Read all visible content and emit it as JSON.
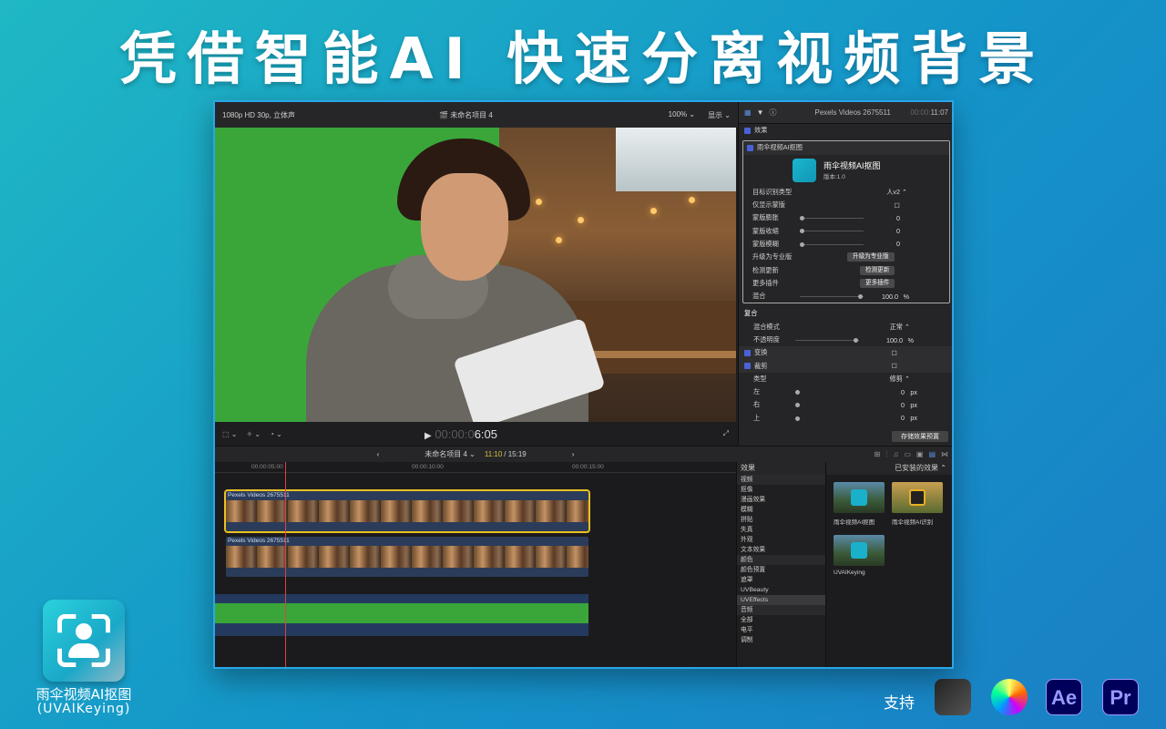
{
  "headline": "凭借智能AI 快速分离视频背景",
  "viewer": {
    "format": "1080p HD 30p, 立体声",
    "project": "未命名项目 4",
    "zoom": "100% ⌄",
    "display": "显示 ⌄",
    "timecode_dim": "00:00:0",
    "timecode": "6:05"
  },
  "inspector": {
    "clip_name": "Pexels Videos 2675511",
    "timecode_dim": "00:00:",
    "timecode": "11:07",
    "effects_label": "效果",
    "plugin_label": "雨伞视频AI抠图",
    "plugin_title": "雨伞视频AI抠图",
    "plugin_version": "版本:1.0",
    "params": [
      {
        "label": "目标识别类型",
        "value": "人v2 ⌃"
      },
      {
        "label": "仅显示蒙版",
        "value": "☐"
      },
      {
        "label": "蒙版膨胀",
        "value": "0"
      },
      {
        "label": "蒙版收缩",
        "value": "0"
      },
      {
        "label": "蒙版模糊",
        "value": "0"
      }
    ],
    "upgrade_label": "升级为专业版",
    "upgrade_btn": "升级为专业版",
    "update_label": "检测更新",
    "update_btn": "检测更新",
    "more_label": "更多插件",
    "more_btn": "更多插件",
    "mix_label": "混合",
    "mix_value": "100.0",
    "mix_unit": "%",
    "composite_label": "复合",
    "blend_label": "混合模式",
    "blend_value": "正常 ⌃",
    "opacity_label": "不透明度",
    "opacity_value": "100.0",
    "opacity_unit": "%",
    "transform_label": "变换",
    "crop_label": "裁剪",
    "crop_type_label": "类型",
    "crop_type_value": "修剪 ⌃",
    "crop_rows": [
      {
        "label": "左",
        "value": "0",
        "unit": "px"
      },
      {
        "label": "右",
        "value": "0",
        "unit": "px"
      },
      {
        "label": "上",
        "value": "0",
        "unit": "px"
      }
    ],
    "save_preset": "存储效果预置"
  },
  "timeline": {
    "project": "未命名项目 4 ⌄",
    "duration_current": "11:10",
    "duration_total": "/ 15:19",
    "ruler": [
      "00:00:05:00",
      "00:00:10:00",
      "00:00:15:00"
    ],
    "clip_label": "Pexels Videos 2675511"
  },
  "effects_browser": {
    "header": "效果",
    "items": [
      {
        "label": "视频",
        "kind": "grp"
      },
      {
        "label": "抠像",
        "kind": ""
      },
      {
        "label": "漫画效果",
        "kind": ""
      },
      {
        "label": "模糊",
        "kind": ""
      },
      {
        "label": "拼贴",
        "kind": ""
      },
      {
        "label": "失真",
        "kind": ""
      },
      {
        "label": "外观",
        "kind": ""
      },
      {
        "label": "文本效果",
        "kind": ""
      },
      {
        "label": "颜色",
        "kind": "grp"
      },
      {
        "label": "颜色预置",
        "kind": ""
      },
      {
        "label": "遮罩",
        "kind": ""
      },
      {
        "label": "UVBeauty",
        "kind": ""
      },
      {
        "label": "UVEffects",
        "kind": "sel"
      },
      {
        "label": "音频",
        "kind": "grp"
      },
      {
        "label": "全部",
        "kind": ""
      },
      {
        "label": "电平",
        "kind": ""
      },
      {
        "label": "调制",
        "kind": ""
      }
    ],
    "installed": "已安装的效果 ⌃",
    "tiles": [
      {
        "label": "雨伞视频AI抠图"
      },
      {
        "label": "雨伞视频AI识别"
      },
      {
        "label": "UVAIKeying"
      }
    ]
  },
  "badge": {
    "name": "雨伞视频AI抠图",
    "subname": "(UVAIKeying)"
  },
  "support": {
    "label": "支持",
    "ae": "Ae",
    "pr": "Pr"
  }
}
